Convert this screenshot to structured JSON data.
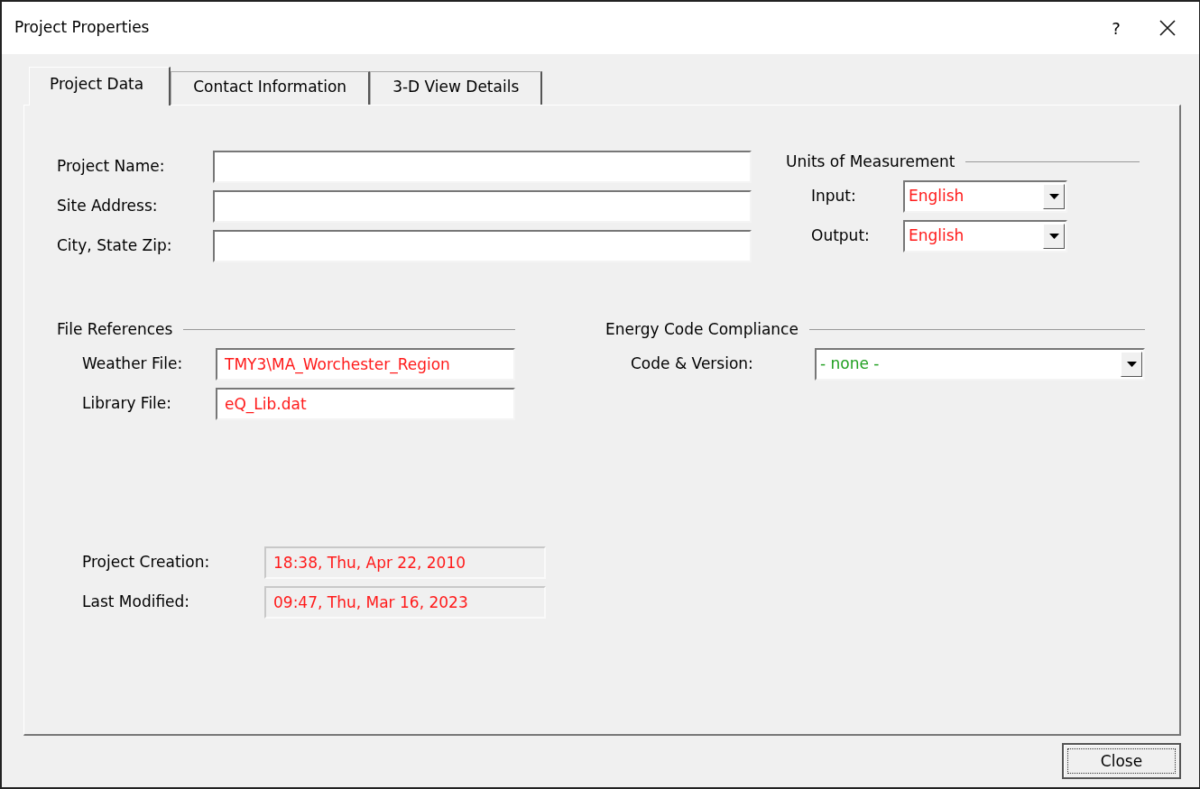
{
  "window": {
    "title": "Project Properties",
    "help": "?"
  },
  "tabs": [
    {
      "label": "Project Data",
      "selected": true
    },
    {
      "label": "Contact Information",
      "selected": false
    },
    {
      "label": "3-D View Details",
      "selected": false
    }
  ],
  "project_fields": [
    {
      "label": "Project Name:"
    },
    {
      "label": "Site Address:"
    },
    {
      "label": "City, State Zip:"
    }
  ],
  "units": {
    "title": "Units of Measurement",
    "fields": [
      {
        "label": "Input:",
        "value": "English",
        "color": "#ff1a1a"
      },
      {
        "label": "Output:",
        "value": "English",
        "color": "#ff1a1a"
      }
    ]
  },
  "file_references": {
    "title": "File References",
    "fields": [
      {
        "label": "Weather File:",
        "value": "TMY3\\MA_Worchester_Region",
        "color": "#ff1a1a"
      },
      {
        "label": "Library File:",
        "value": "eQ_Lib.dat",
        "color": "#ff1a1a"
      }
    ]
  },
  "energy_code": {
    "title": "Energy Code Compliance",
    "fields": [
      {
        "label": "Code & Version:",
        "value": "- none -",
        "color": "#22a022"
      }
    ]
  },
  "dates": [
    {
      "label": "Project Creation:",
      "value": "18:38, Thu, Apr 22, 2010",
      "color": "#ff1a1a"
    },
    {
      "label": "Last Modified:",
      "value": "09:47, Thu, Mar 16, 2023",
      "color": "#ff1a1a"
    }
  ],
  "buttons": [
    {
      "label": "Close"
    }
  ]
}
